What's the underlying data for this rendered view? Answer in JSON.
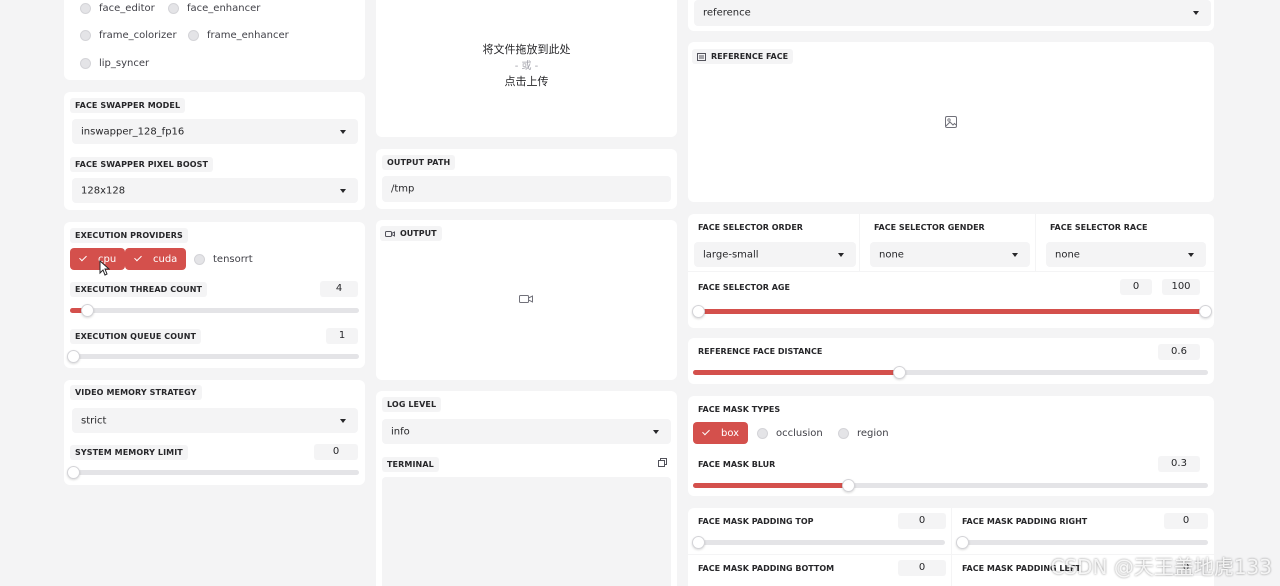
{
  "processors": {
    "items": [
      {
        "label": "face_editor"
      },
      {
        "label": "face_enhancer"
      },
      {
        "label": "frame_colorizer"
      },
      {
        "label": "frame_enhancer"
      },
      {
        "label": "lip_syncer"
      }
    ]
  },
  "face_swapper": {
    "model_label": "FACE SWAPPER MODEL",
    "model_value": "inswapper_128_fp16",
    "pixel_boost_label": "FACE SWAPPER PIXEL BOOST",
    "pixel_boost_value": "128x128"
  },
  "execution": {
    "providers_label": "EXECUTION PROVIDERS",
    "providers": [
      {
        "label": "cpu",
        "checked": true
      },
      {
        "label": "cuda",
        "checked": true
      },
      {
        "label": "tensorrt",
        "checked": false
      }
    ],
    "thread_count_label": "EXECUTION THREAD COUNT",
    "thread_count_value": "4",
    "thread_count_fraction": 0.06,
    "queue_count_label": "EXECUTION QUEUE COUNT",
    "queue_count_value": "1",
    "queue_count_fraction": 0
  },
  "memory": {
    "strategy_label": "VIDEO MEMORY STRATEGY",
    "strategy_value": "strict",
    "limit_label": "SYSTEM MEMORY LIMIT",
    "limit_value": "0",
    "limit_fraction": 0
  },
  "upload": {
    "drop_text": "将文件拖放到此处",
    "or_text": "- 或 -",
    "click_text": "点击上传"
  },
  "output_path": {
    "label": "OUTPUT PATH",
    "value": "/tmp"
  },
  "output": {
    "label": "OUTPUT",
    "icon": "video-camera-icon"
  },
  "log": {
    "label": "LOG LEVEL",
    "value": "info"
  },
  "terminal": {
    "label": "TERMINAL",
    "icon": "copy-icon"
  },
  "face_selector": {
    "mode_value": "reference",
    "reference_face_label": "REFERENCE FACE",
    "order_label": "FACE SELECTOR ORDER",
    "order_value": "large-small",
    "gender_label": "FACE SELECTOR GENDER",
    "gender_value": "none",
    "race_label": "FACE SELECTOR RACE",
    "race_value": "none",
    "age_label": "FACE SELECTOR AGE",
    "age_min": "0",
    "age_max": "100",
    "age_min_fraction": 0,
    "age_max_fraction": 1
  },
  "reference_distance": {
    "label": "REFERENCE FACE DISTANCE",
    "value": "0.6",
    "fraction": 0.4
  },
  "face_mask": {
    "types_label": "FACE MASK TYPES",
    "types": [
      {
        "label": "box",
        "checked": true
      },
      {
        "label": "occlusion",
        "checked": false
      },
      {
        "label": "region",
        "checked": false
      }
    ],
    "blur_label": "FACE MASK BLUR",
    "blur_value": "0.3",
    "blur_fraction": 0.3,
    "padding_top_label": "FACE MASK PADDING TOP",
    "padding_top_value": "0",
    "padding_right_label": "FACE MASK PADDING RIGHT",
    "padding_right_value": "0",
    "padding_bottom_label": "FACE MASK PADDING BOTTOM",
    "padding_bottom_value": "0",
    "padding_left_label": "FACE MASK PADDING LEFT",
    "padding_left_value": "0"
  },
  "watermark": "CSDN @天王盖地虎133",
  "colors": {
    "accent": "#d4504c",
    "panel": "#ffffff",
    "background": "#f4f4f5"
  }
}
